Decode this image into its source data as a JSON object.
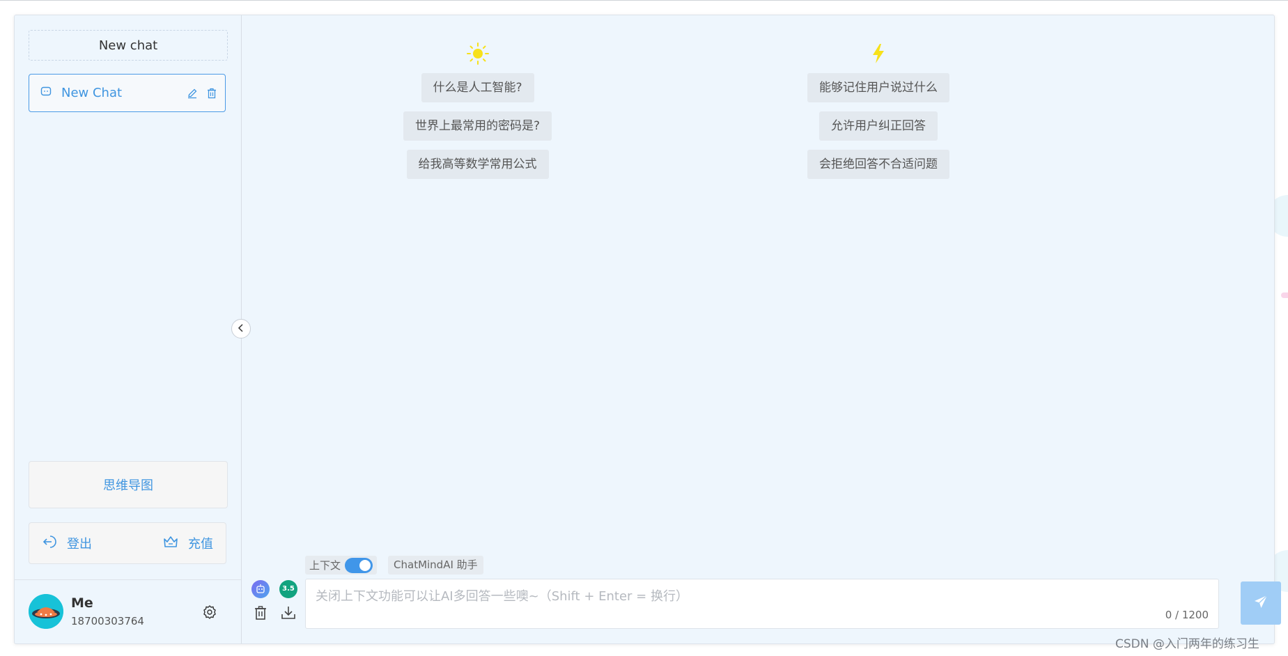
{
  "sidebar": {
    "new_chat_label": "New chat",
    "chats": [
      {
        "title": "New Chat"
      }
    ],
    "mindmap_label": "思维导图",
    "logout_label": "登出",
    "recharge_label": "充值",
    "user": {
      "name": "Me",
      "phone": "18700303764"
    }
  },
  "suggestions": {
    "left": [
      "什么是人工智能?",
      "世界上最常用的密码是?",
      "给我高等数学常用公式"
    ],
    "right": [
      "能够记住用户说过什么",
      "允许用户纠正回答",
      "会拒绝回答不合适问题"
    ]
  },
  "composer": {
    "context_label": "上下文",
    "context_enabled": true,
    "assistant_label": "ChatMindAI 助手",
    "model_badge": "3.5",
    "placeholder": "关闭上下文功能可以让AI多回答一些噢~（Shift + Enter = 换行）",
    "counter": "0 / 1200"
  },
  "watermark": "CSDN @入门两年的练习生",
  "colors": {
    "accent": "#3f95e0",
    "app_bg": "#eef6fd",
    "send_btn": "#a0cdf6",
    "sun_icon": "#f7e11a"
  },
  "icons": [
    "chat-bubble-icon",
    "edit-icon",
    "trash-icon",
    "logout-icon",
    "crown-icon",
    "gear-icon",
    "chevron-left-icon",
    "sun-icon",
    "lightning-icon",
    "robot-icon",
    "download-icon",
    "send-icon"
  ]
}
